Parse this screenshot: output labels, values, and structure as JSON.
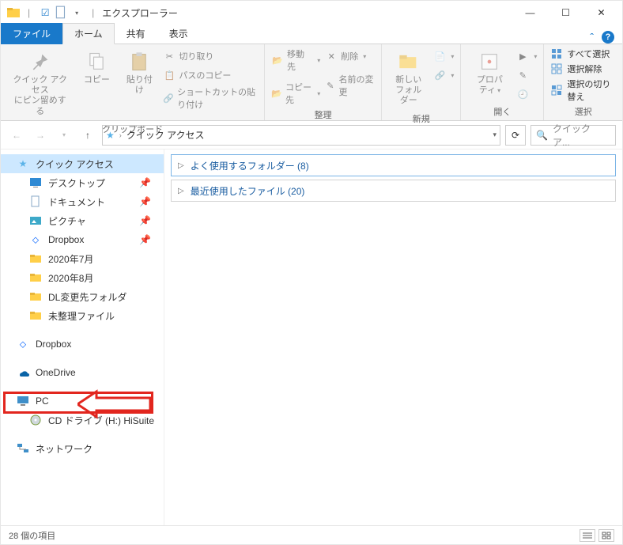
{
  "window": {
    "title": "エクスプローラー",
    "qa_checked": "☑"
  },
  "win_controls": {
    "min": "—",
    "max": "☐",
    "close": "✕"
  },
  "tabs": {
    "file": "ファイル",
    "home": "ホーム",
    "share": "共有",
    "view": "表示",
    "caret": "ˆ",
    "help": "?"
  },
  "ribbon": {
    "clipboard": {
      "pin": "クイック アクセス\nにピン留めする",
      "copy": "コピー",
      "paste": "貼り付け",
      "cut": "切り取り",
      "copy_path": "パスのコピー",
      "paste_shortcut": "ショートカットの貼り付け",
      "label": "クリップボード"
    },
    "organize": {
      "move_to": "移動先",
      "copy_to": "コピー先",
      "delete": "削除",
      "rename": "名前の変更",
      "label": "整理"
    },
    "new": {
      "new_folder": "新しい\nフォルダー",
      "label": "新規"
    },
    "open": {
      "properties": "プロパティ",
      "label": "開く"
    },
    "select": {
      "select_all": "すべて選択",
      "select_none": "選択解除",
      "invert": "選択の切り替え",
      "label": "選択"
    }
  },
  "address": {
    "location_icon": "★",
    "location": "クイック アクセス",
    "refresh": "⟳",
    "search_icon": "🔍",
    "search_placeholder": "クイック ア..."
  },
  "nav": {
    "quick_access": "クイック アクセス",
    "desktop": "デスクトップ",
    "documents": "ドキュメント",
    "pictures": "ピクチャ",
    "dropbox_qa": "Dropbox",
    "f_2020_07": "2020年7月",
    "f_2020_08": "2020年8月",
    "f_dl": "DL変更先フォルダ",
    "f_unsorted": "未整理ファイル",
    "dropbox": "Dropbox",
    "onedrive": "OneDrive",
    "pc": "PC",
    "cd_drive": "CD ドライブ (H:) HiSuite",
    "network": "ネットワーク"
  },
  "content": {
    "group1": "よく使用するフォルダー (8)",
    "group2": "最近使用したファイル (20)"
  },
  "status": {
    "items": "28 個の項目"
  }
}
